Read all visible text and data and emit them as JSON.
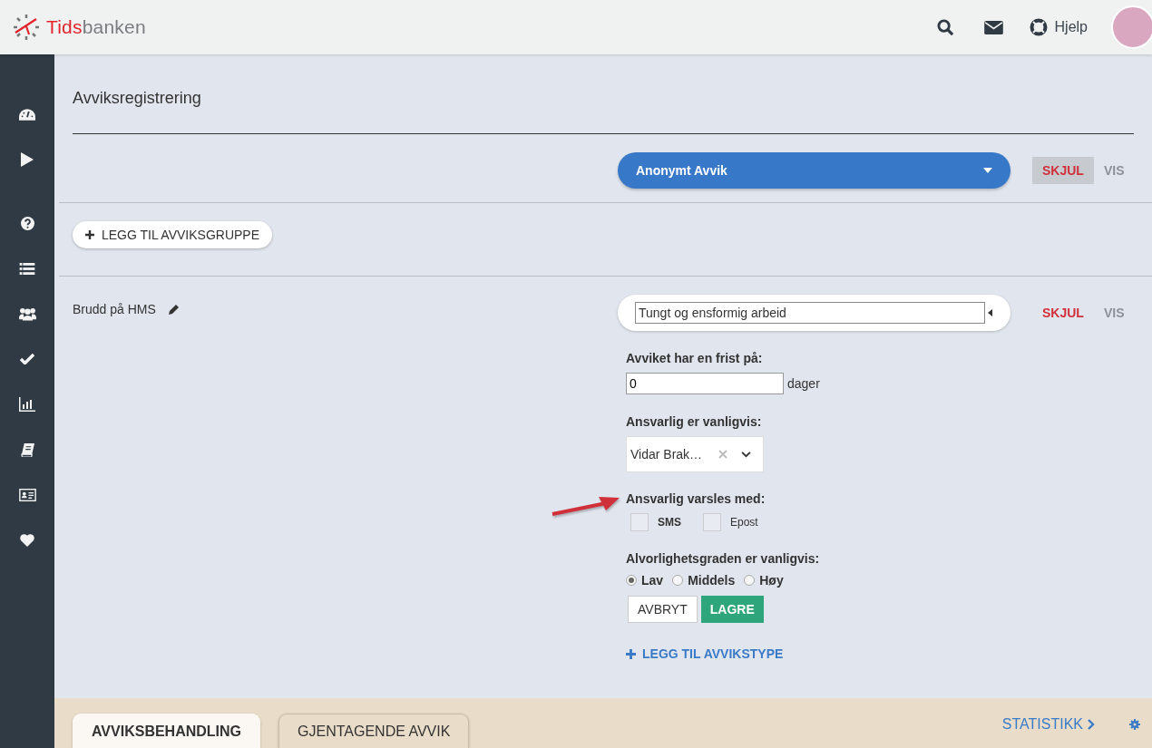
{
  "logo": {
    "highlight": "Tids",
    "rest": "banken"
  },
  "header": {
    "help": "Hjelp"
  },
  "sidebar": {
    "items": [
      {
        "kind": "gauge"
      },
      {
        "kind": "play"
      },
      {
        "kind": "question"
      },
      {
        "kind": "list"
      },
      {
        "kind": "users"
      },
      {
        "kind": "check"
      },
      {
        "kind": "chart"
      },
      {
        "kind": "book"
      },
      {
        "kind": "card"
      },
      {
        "kind": "heart"
      }
    ]
  },
  "page_title": "Avviksregistrering",
  "anonymous_row": {
    "dropdown": "Anonymt Avvik",
    "toggle": [
      {
        "label": "SKJUL",
        "kind": "hide",
        "selected": true
      },
      {
        "label": "VIS",
        "kind": "show",
        "selected": false
      }
    ]
  },
  "add_group_button": "LEGG TIL AVVIKSGRUPPE",
  "group": {
    "name": "Brudd på HMS",
    "type_field": {
      "value": "Tungt og ensformig arbeid"
    },
    "toggle": [
      {
        "label": "SKJUL",
        "kind": "hide",
        "selected": false
      },
      {
        "label": "VIS",
        "kind": "show",
        "selected": false
      }
    ],
    "form": {
      "deadline_label": "Avviket har en frist på:",
      "deadline_value": "0",
      "deadline_unit": "dager",
      "responsible_label": "Ansvarlig er vanligvis:",
      "responsible_value": "Vidar Brak…",
      "notify_label": "Ansvarlig varsles med:",
      "notify_options": [
        {
          "label": "SMS",
          "checked": false
        },
        {
          "label": "Epost",
          "checked": false
        }
      ],
      "severity_label": "Alvorlighetsgraden er vanligvis:",
      "severity_options": [
        {
          "label": "Lav",
          "selected": true
        },
        {
          "label": "Middels",
          "selected": false
        },
        {
          "label": "Høy",
          "selected": false
        }
      ],
      "cancel_button": "AVBRYT",
      "save_button": "LAGRE",
      "add_type_link": "LEGG TIL AVVIKSTYPE"
    }
  },
  "bottom_tabs": [
    {
      "label": "AVVIKSBEHANDLING",
      "selected": true
    },
    {
      "label": "GJENTAGENDE AVVIK",
      "selected": false
    }
  ],
  "statistics_link": "STATISTIKK"
}
